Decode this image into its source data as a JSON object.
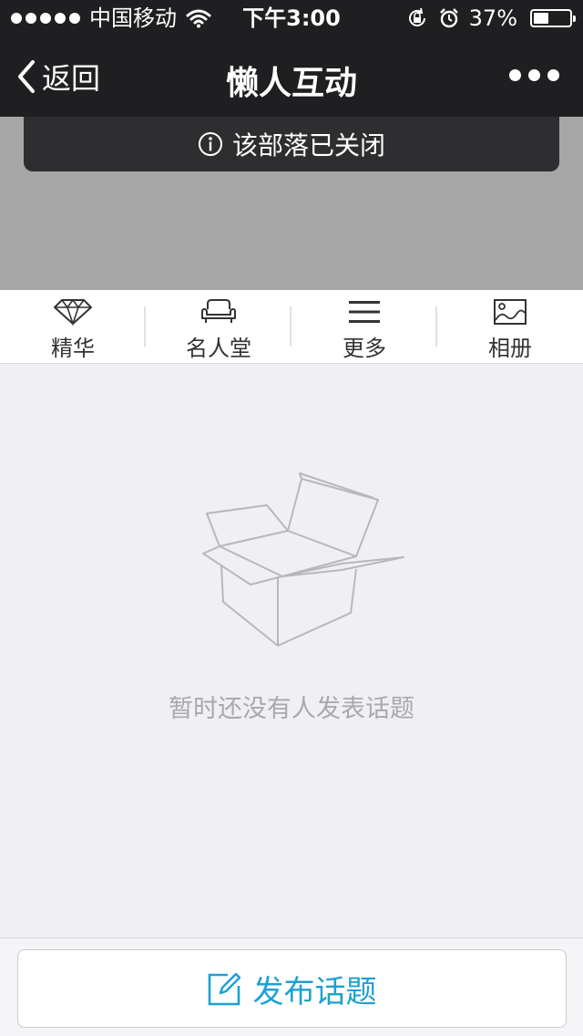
{
  "status_bar": {
    "carrier": "中国移动",
    "time": "下午3:00",
    "battery_percent": "37%",
    "battery_level": 0.37
  },
  "nav": {
    "back_label": "返回",
    "title": "懒人互动"
  },
  "notice": {
    "text": "该部落已关闭"
  },
  "tabs": [
    {
      "label": "精华",
      "icon": "diamond-icon"
    },
    {
      "label": "名人堂",
      "icon": "sofa-icon"
    },
    {
      "label": "更多",
      "icon": "menu-icon"
    },
    {
      "label": "相册",
      "icon": "photo-icon"
    }
  ],
  "empty_state": {
    "text": "暂时还没有人发表话题",
    "icon": "open-box-icon"
  },
  "bottom": {
    "post_label": "发布话题",
    "icon": "edit-icon"
  },
  "colors": {
    "topbar": "#1f1f22",
    "accent": "#1da1d2",
    "background": "#efeff4"
  }
}
